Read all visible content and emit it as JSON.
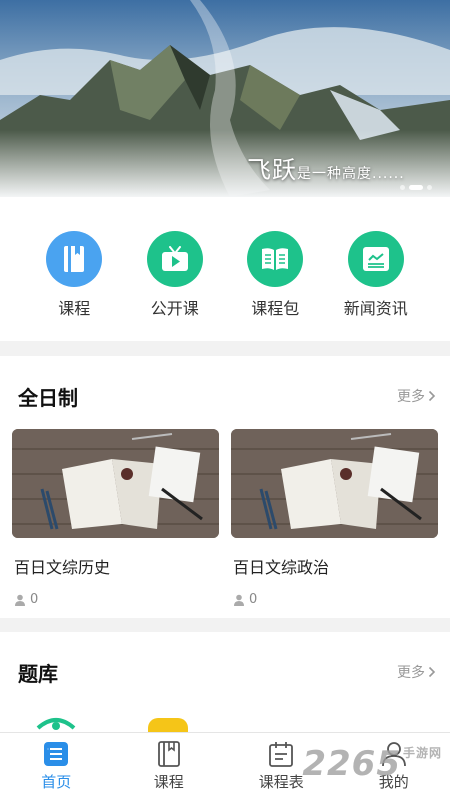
{
  "banner": {
    "caption_main": "飞跃",
    "caption_tail": "是一种高度......",
    "slides": 3,
    "active_slide": 2
  },
  "quick_menu": [
    {
      "label": "课程",
      "icon": "course-book-icon",
      "color": "#4aa3f0"
    },
    {
      "label": "公开课",
      "icon": "tv-play-icon",
      "color": "#1ec28b"
    },
    {
      "label": "课程包",
      "icon": "open-book-icon",
      "color": "#1ec28b"
    },
    {
      "label": "新闻资讯",
      "icon": "news-card-icon",
      "color": "#1ec28b"
    }
  ],
  "section_fulltime": {
    "title": "全日制",
    "more": "更多",
    "cards": [
      {
        "title": "百日文综历史",
        "count": "0"
      },
      {
        "title": "百日文综政治",
        "count": "0"
      }
    ]
  },
  "section_bank": {
    "title": "题库",
    "more": "更多"
  },
  "tabbar": [
    {
      "label": "首页",
      "icon": "home-list-icon",
      "active": true
    },
    {
      "label": "课程",
      "icon": "bookmark-book-icon",
      "active": false
    },
    {
      "label": "课程表",
      "icon": "schedule-icon",
      "active": false
    },
    {
      "label": "我的",
      "icon": "user-icon",
      "active": false
    }
  ],
  "watermark": {
    "text": "2265",
    "sub": "手游网"
  },
  "colors": {
    "accent": "#2a8ee8",
    "blue_icon": "#4aa3f0",
    "green_icon": "#1ec28b"
  }
}
